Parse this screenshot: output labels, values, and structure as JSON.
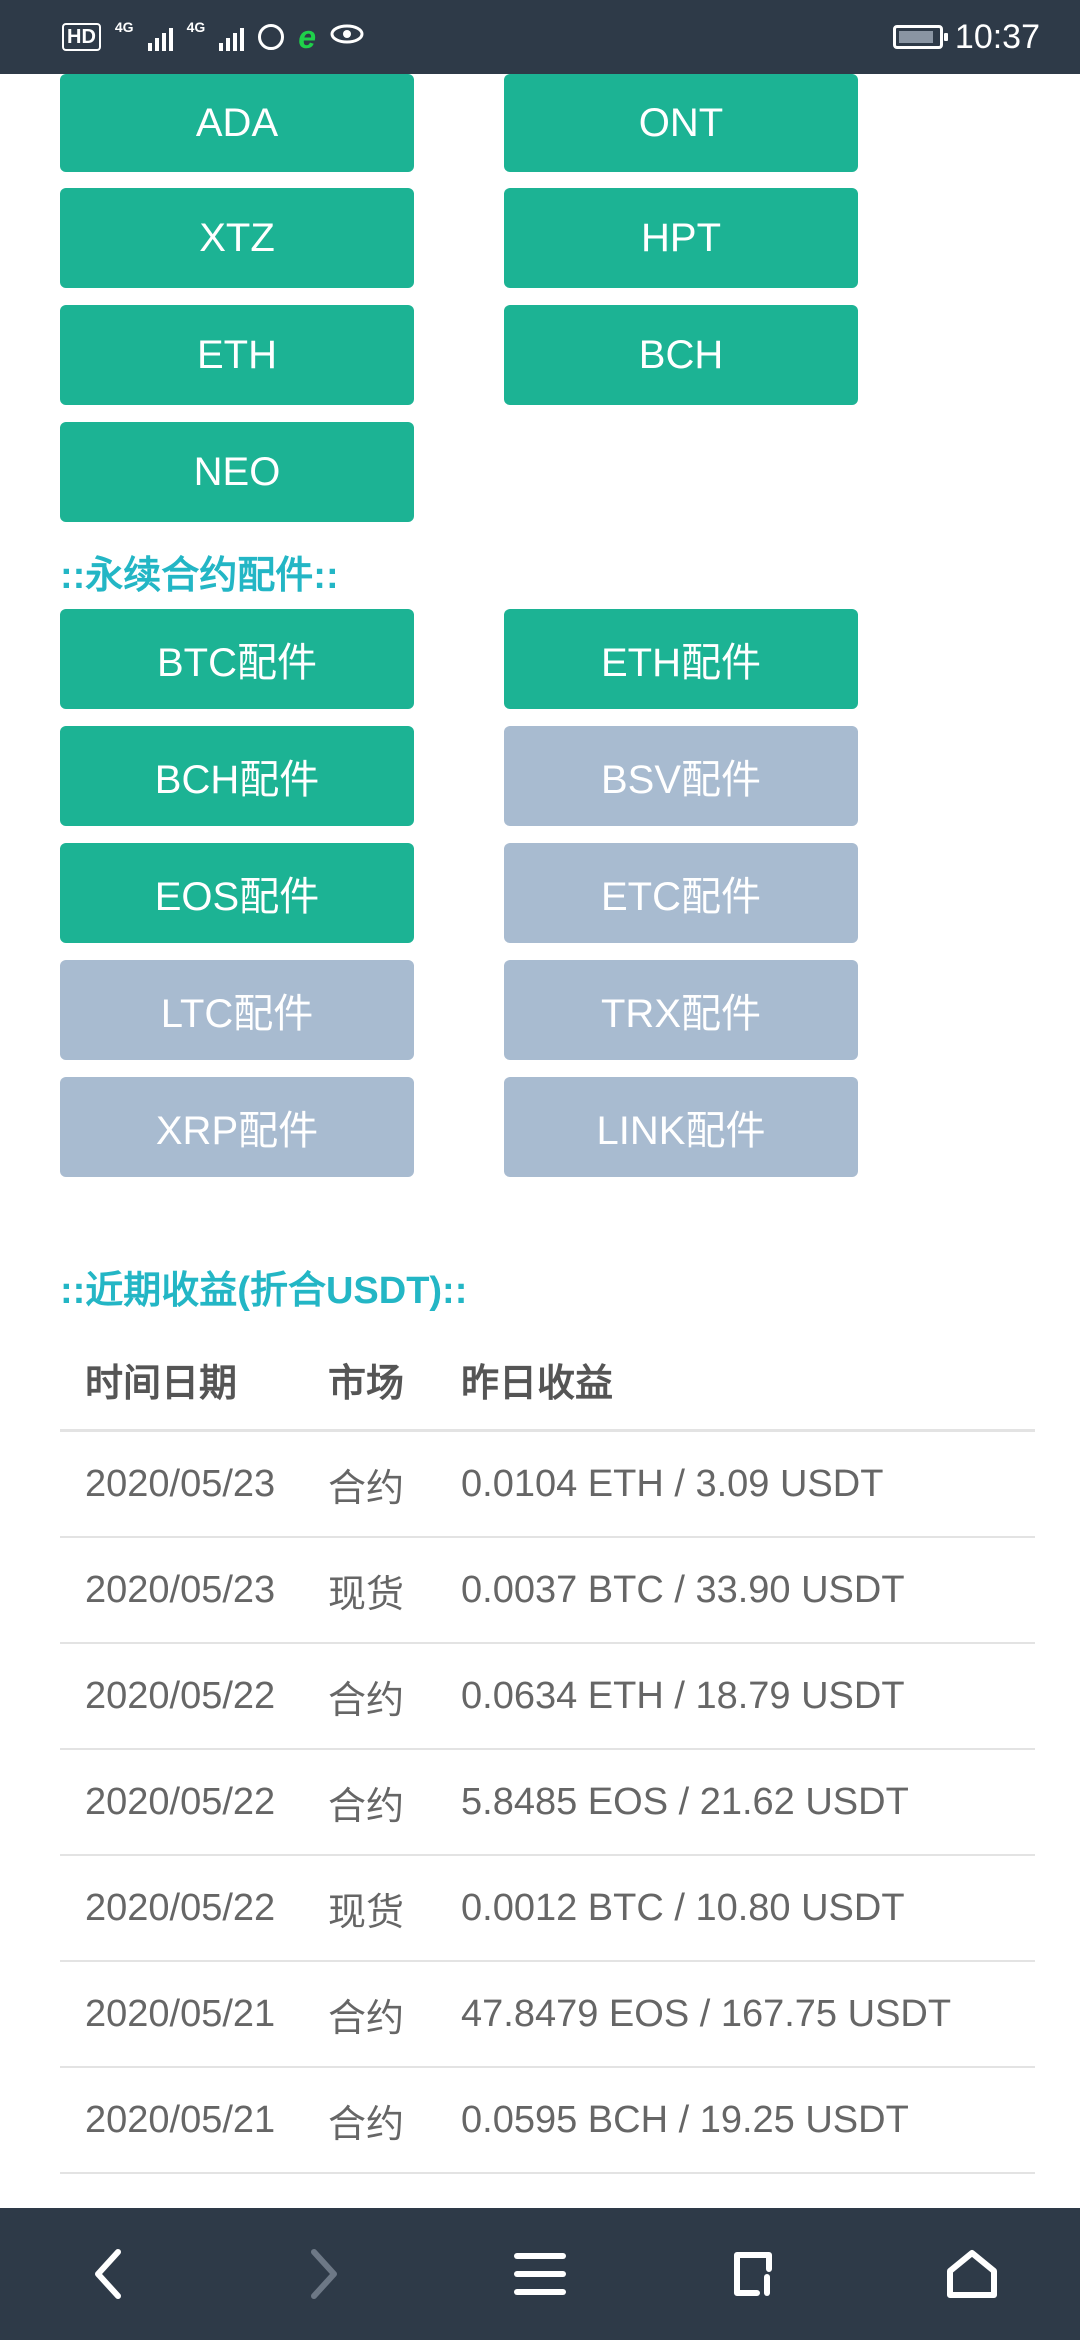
{
  "status_bar": {
    "hd": "HD",
    "net1": "4G",
    "net2": "4G",
    "time": "10:37"
  },
  "top_buttons": [
    {
      "label": "ADA",
      "color": "green"
    },
    {
      "label": "ONT",
      "color": "green"
    },
    {
      "label": "XTZ",
      "color": "green"
    },
    {
      "label": "HPT",
      "color": "green"
    },
    {
      "label": "ETH",
      "color": "green"
    },
    {
      "label": "BCH",
      "color": "green"
    },
    {
      "label": "NEO",
      "color": "green"
    }
  ],
  "perpetual_section": {
    "title": "::永续合约配件::",
    "buttons": [
      {
        "label": "BTC配件",
        "color": "green"
      },
      {
        "label": "ETH配件",
        "color": "green"
      },
      {
        "label": "BCH配件",
        "color": "green"
      },
      {
        "label": "BSV配件",
        "color": "grey"
      },
      {
        "label": "EOS配件",
        "color": "green"
      },
      {
        "label": "ETC配件",
        "color": "grey"
      },
      {
        "label": "LTC配件",
        "color": "grey"
      },
      {
        "label": "TRX配件",
        "color": "grey"
      },
      {
        "label": "XRP配件",
        "color": "grey"
      },
      {
        "label": "LINK配件",
        "color": "grey"
      }
    ]
  },
  "earnings_section": {
    "title": "::近期收益(折合USDT)::",
    "headers": [
      "时间日期",
      "市场",
      "昨日收益"
    ],
    "rows": [
      [
        "2020/05/23",
        "合约",
        "0.0104 ETH / 3.09 USDT"
      ],
      [
        "2020/05/23",
        "现货",
        "0.0037 BTC / 33.90 USDT"
      ],
      [
        "2020/05/22",
        "合约",
        "0.0634 ETH / 18.79 USDT"
      ],
      [
        "2020/05/22",
        "合约",
        "5.8485 EOS / 21.62 USDT"
      ],
      [
        "2020/05/22",
        "现货",
        "0.0012 BTC / 10.80 USDT"
      ],
      [
        "2020/05/21",
        "合约",
        "47.8479 EOS / 167.75 USDT"
      ],
      [
        "2020/05/21",
        "合约",
        "0.0595 BCH / 19.25 USDT"
      ]
    ]
  },
  "colors": {
    "green": "#1cb394",
    "grey": "#a8bbd0",
    "title": "#23b6c5",
    "bar": "#2e3a48"
  },
  "nav_icons": [
    "back-icon",
    "forward-icon",
    "menu-icon",
    "tabs-icon",
    "home-icon"
  ]
}
